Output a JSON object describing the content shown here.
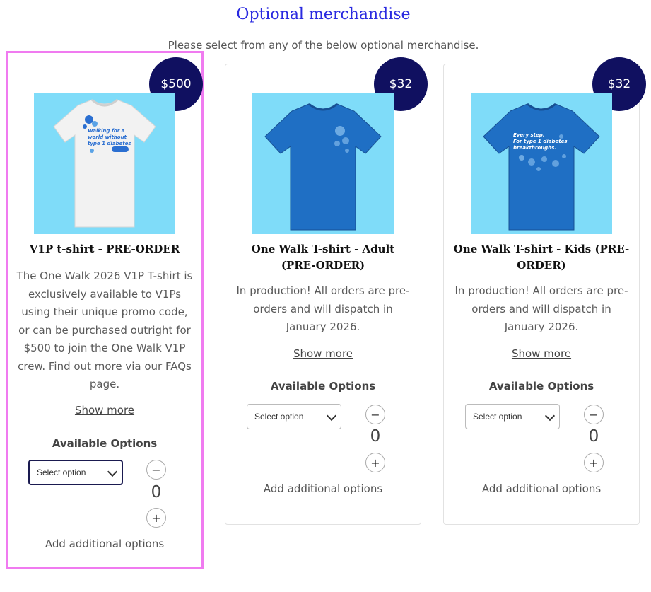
{
  "header": {
    "title": "Optional merchandise",
    "subtitle": "Please select from any of the below optional merchandise."
  },
  "products": [
    {
      "price": "$500",
      "name": "V1P t-shirt - PRE-ORDER",
      "description": "The One Walk 2026 V1P T-shirt is exclusively available to V1Ps using their unique promo code, or can be purchased outright for $500 to join the One Walk V1P crew. Find out more via our FAQs page.",
      "show_more": "Show more",
      "options_heading": "Available Options",
      "select_placeholder": "Select option",
      "quantity": "0",
      "add_options": "Add additional options",
      "shirt_color": "#f2f2f2",
      "shirt_print": [
        "Walking for a",
        "world without",
        "type 1 diabetes"
      ]
    },
    {
      "price": "$32",
      "name": "One Walk T-shirt - Adult (PRE-ORDER)",
      "description": "In production! All orders are pre-orders and will dispatch in January 2026.",
      "show_more": "Show more",
      "options_heading": "Available Options",
      "select_placeholder": "Select option",
      "quantity": "0",
      "add_options": "Add additional options",
      "shirt_color": "#1f6fc4"
    },
    {
      "price": "$32",
      "name": "One Walk T-shirt - Kids (PRE-ORDER)",
      "description": "In production! All orders are pre-orders and will dispatch in January 2026.",
      "show_more": "Show more",
      "options_heading": "Available Options",
      "select_placeholder": "Select option",
      "quantity": "0",
      "add_options": "Add additional options",
      "shirt_color": "#1f6fc4",
      "shirt_print": [
        "Every step.",
        "For type 1 diabetes",
        "breakthroughs."
      ]
    }
  ],
  "colors": {
    "title": "#2a2ae0",
    "badge": "#101060",
    "image_bg": "#7fdcf9",
    "highlight": "#f07bf0"
  },
  "icons": {
    "minus": "minus-icon",
    "plus": "plus-icon",
    "chevron": "chevron-down-icon"
  }
}
